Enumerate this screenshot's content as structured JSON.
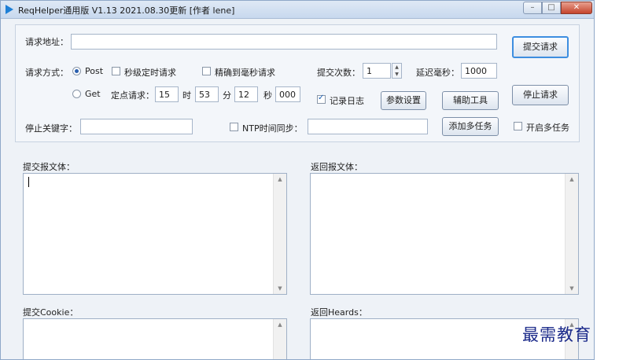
{
  "window": {
    "title": "ReqHelper通用版 V1.13  2021.08.30更新  [作者 lene]",
    "controls": {
      "minimize": "–",
      "maximize": "□",
      "close": "✕"
    }
  },
  "form": {
    "url_label": "请求地址：",
    "url_value": "",
    "submit_button": "提交请求",
    "method_label": "请求方式：",
    "method_post": "Post",
    "method_get": "Get",
    "method_selected": "Post",
    "second_timer_label": "秒级定时请求",
    "second_timer_checked": false,
    "precise_ms_label": "精确到毫秒请求",
    "precise_ms_checked": false,
    "submit_count_label": "提交次数：",
    "submit_count_value": "1",
    "delay_ms_label": "延迟毫秒：",
    "delay_ms_value": "1000",
    "scheduled_label": "定点请求：",
    "sched_hour": "15",
    "hour_unit": "时",
    "sched_minute": "53",
    "minute_unit": "分",
    "sched_second": "12",
    "second_unit": "秒",
    "sched_ms": "000",
    "log_label": "记录日志",
    "log_checked": true,
    "param_settings_button": "参数设置",
    "tools_button": "辅助工具",
    "stop_button": "停止请求",
    "stop_keyword_label": "停止关键字：",
    "stop_keyword_value": "",
    "ntp_label": "NTP时间同步：",
    "ntp_checked": false,
    "ntp_value": "",
    "add_tasks_button": "添加多任务",
    "multi_task_label": "开启多任务",
    "multi_task_checked": false
  },
  "panes": {
    "request_body_label": "提交报文体：",
    "response_body_label": "返回报文体：",
    "cookie_label": "提交Cookie：",
    "response_headers_label": "返回Heards："
  },
  "watermark": "最需教育"
}
